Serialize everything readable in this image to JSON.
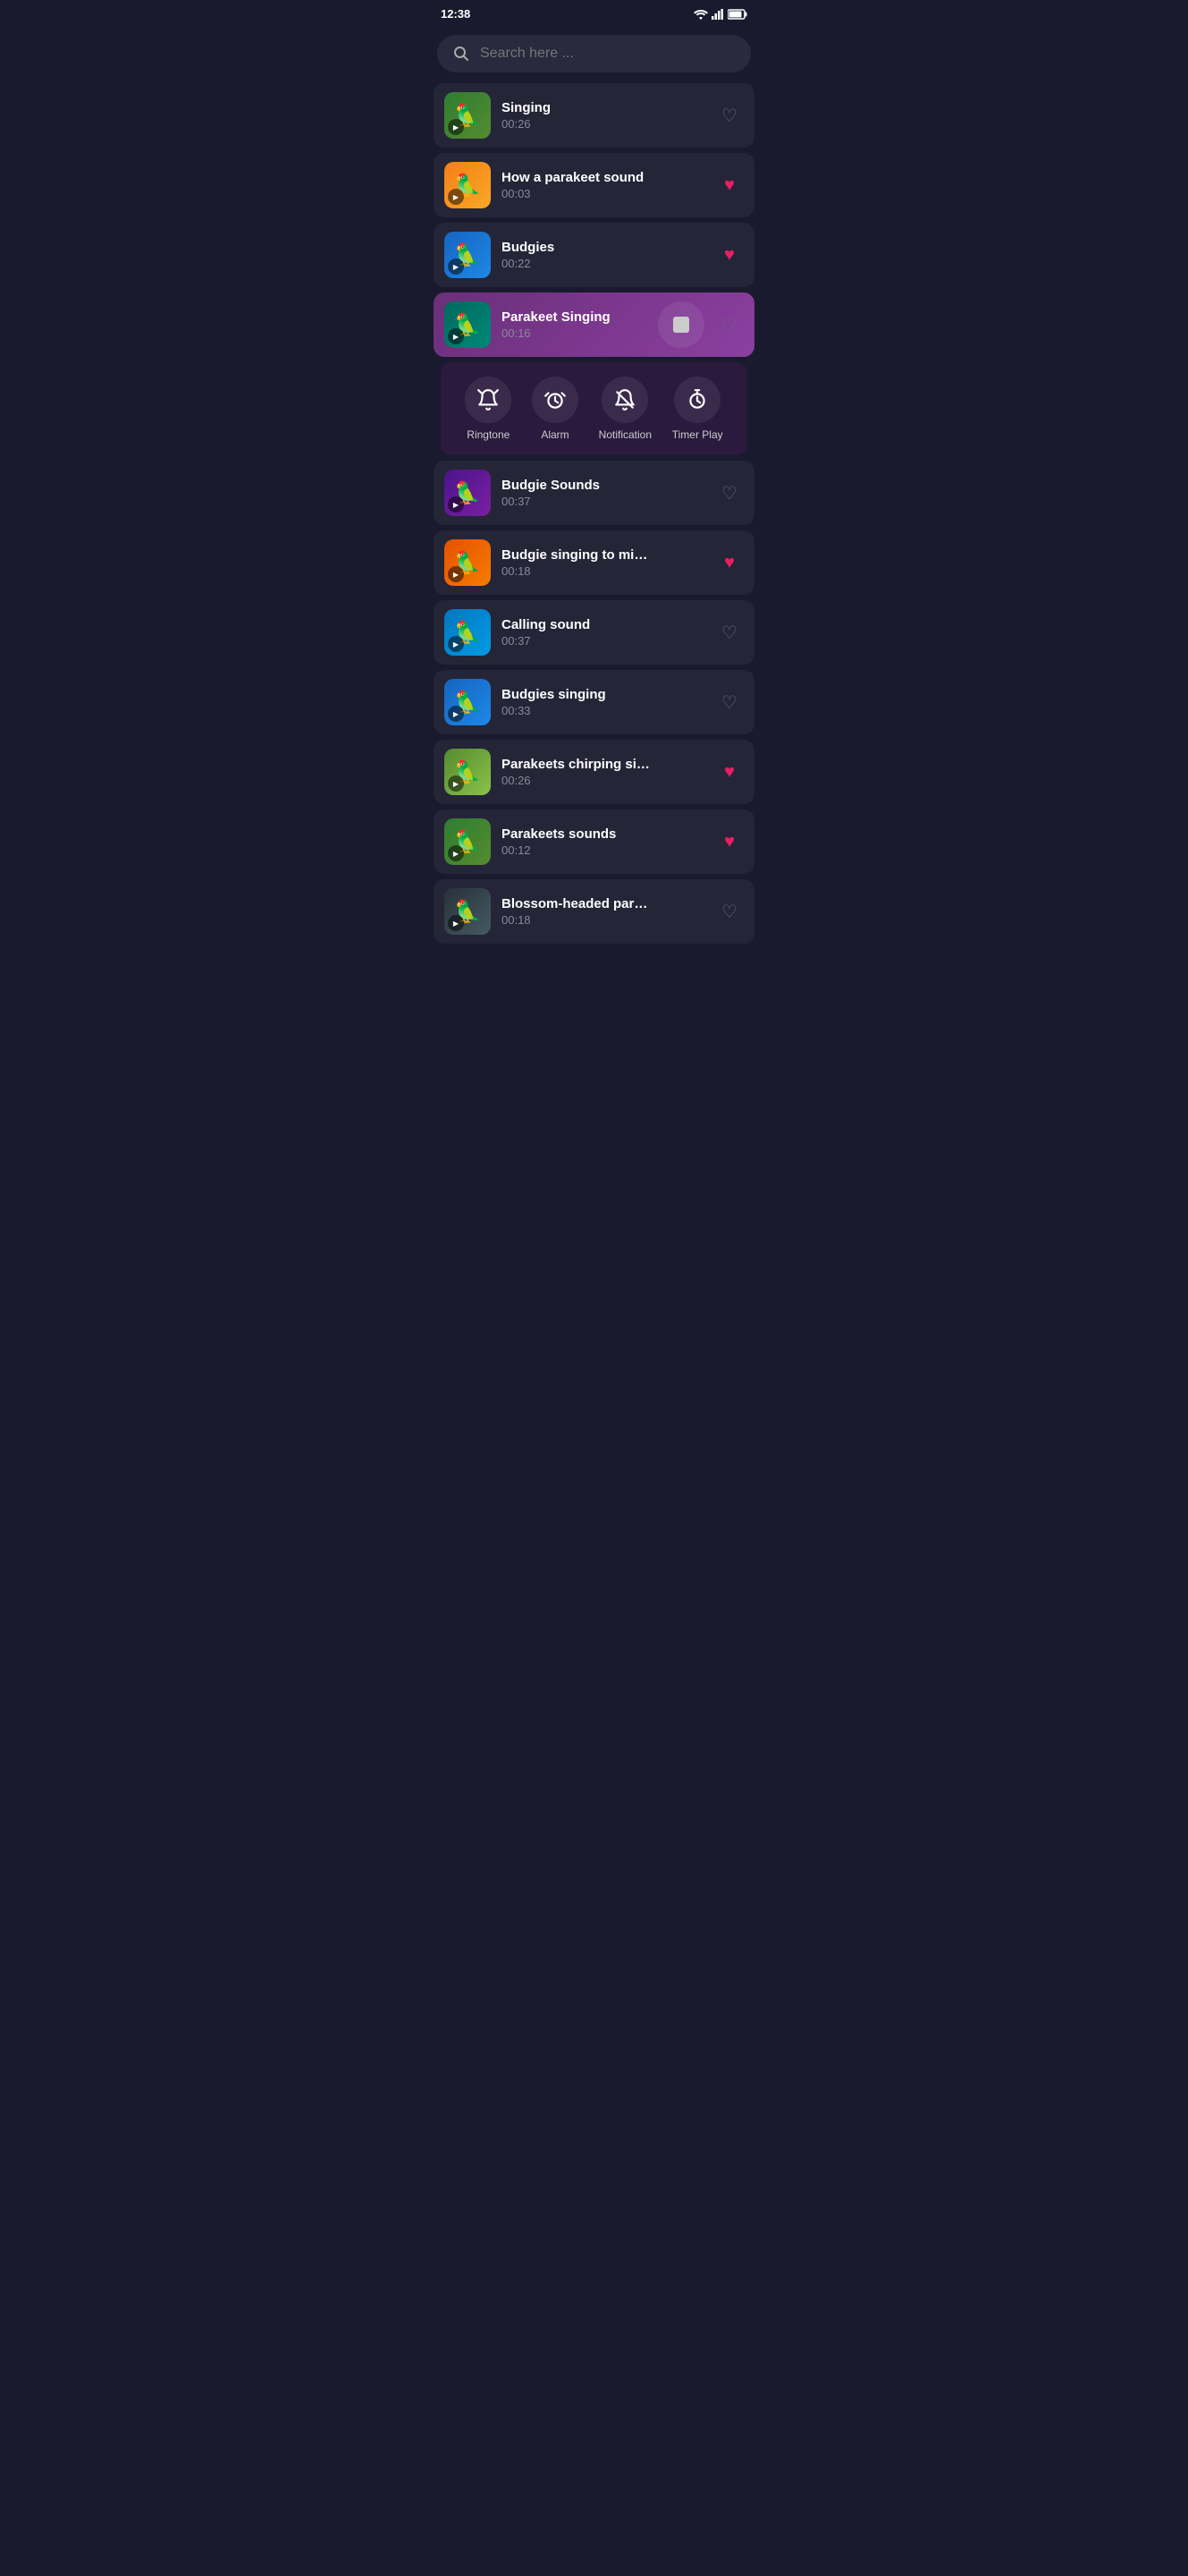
{
  "status_bar": {
    "time": "12:38",
    "icons": [
      "wifi",
      "signal",
      "battery"
    ]
  },
  "search": {
    "placeholder": "Search here ..."
  },
  "songs": [
    {
      "id": 1,
      "title": "Singing",
      "duration": "00:26",
      "bird_color": "green",
      "liked": false,
      "active": false
    },
    {
      "id": 2,
      "title": "How a parakeet sound",
      "duration": "00:03",
      "bird_color": "yellow",
      "liked": true,
      "active": false
    },
    {
      "id": 3,
      "title": "Budgies",
      "duration": "00:22",
      "bird_color": "blue",
      "liked": true,
      "active": false
    },
    {
      "id": 4,
      "title": "Parakeet Singing",
      "duration": "00:16",
      "bird_color": "teal",
      "liked": false,
      "active": true
    },
    {
      "id": 5,
      "title": "Budgie Sounds",
      "duration": "00:37",
      "bird_color": "multi",
      "liked": false,
      "active": false
    },
    {
      "id": 6,
      "title": "Budgie singing to mi…",
      "duration": "00:18",
      "bird_color": "orange",
      "liked": true,
      "active": false
    },
    {
      "id": 7,
      "title": "Calling sound",
      "duration": "00:37",
      "bird_color": "lightblue",
      "liked": false,
      "active": false
    },
    {
      "id": 8,
      "title": "Budgies singing",
      "duration": "00:33",
      "bird_color": "blue",
      "liked": false,
      "active": false
    },
    {
      "id": 9,
      "title": "Parakeets chirping si…",
      "duration": "00:26",
      "bird_color": "lime",
      "liked": true,
      "active": false
    },
    {
      "id": 10,
      "title": "Parakeets sounds",
      "duration": "00:12",
      "bird_color": "green",
      "liked": true,
      "active": false
    },
    {
      "id": 11,
      "title": "Blossom-headed par…",
      "duration": "00:18",
      "bird_color": "dark",
      "liked": false,
      "active": false
    }
  ],
  "active_controls": [
    {
      "id": "ringtone",
      "label": "Ringtone",
      "icon": "🔔"
    },
    {
      "id": "alarm",
      "label": "Alarm",
      "icon": "⏰"
    },
    {
      "id": "notification",
      "label": "Notification",
      "icon": "🔕"
    },
    {
      "id": "timer_play",
      "label": "Timer Play",
      "icon": "⏱"
    }
  ]
}
